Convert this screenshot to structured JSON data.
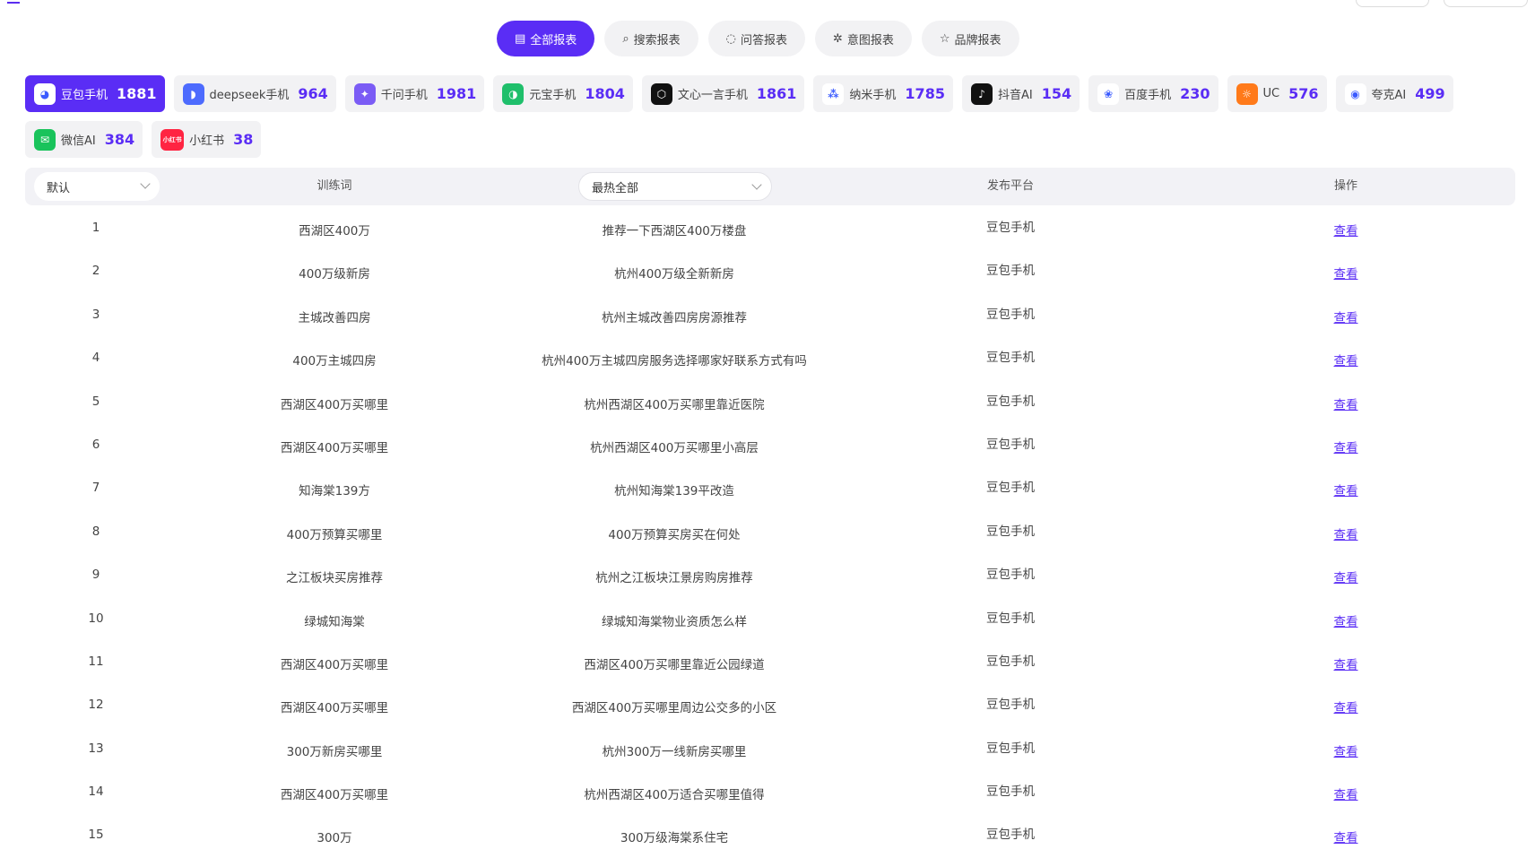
{
  "report_tabs": [
    {
      "label": "全部报表",
      "icon": "document-icon",
      "glyph": "▤",
      "active": true
    },
    {
      "label": "搜索报表",
      "icon": "search-icon",
      "glyph": "⌕",
      "active": false
    },
    {
      "label": "问答报表",
      "icon": "chat-bubble-icon",
      "glyph": "◌",
      "active": false
    },
    {
      "label": "意图报表",
      "icon": "sparkle-icon",
      "glyph": "✲",
      "active": false
    },
    {
      "label": "品牌报表",
      "icon": "star-icon",
      "glyph": "☆",
      "active": false
    }
  ],
  "platforms": [
    {
      "name": "豆包手机",
      "count": "1881",
      "logo": "doubao-logo-icon",
      "color": "#ffffff",
      "glyph": "◕",
      "active": true
    },
    {
      "name": "deepseek手机",
      "count": "964",
      "logo": "deepseek-logo-icon",
      "color": "#4d6bfe",
      "glyph": "◗",
      "active": false
    },
    {
      "name": "千问手机",
      "count": "1981",
      "logo": "qianwen-logo-icon",
      "color": "#7b5cf5",
      "glyph": "✦",
      "active": false
    },
    {
      "name": "元宝手机",
      "count": "1804",
      "logo": "yuanbao-logo-icon",
      "color": "#1fbf6b",
      "glyph": "◑",
      "active": false
    },
    {
      "name": "文心一言手机",
      "count": "1861",
      "logo": "wenxin-logo-icon",
      "color": "#111111",
      "glyph": "⬡",
      "active": false
    },
    {
      "name": "纳米手机",
      "count": "1785",
      "logo": "nami-logo-icon",
      "color": "#ffffff",
      "glyph": "⁂",
      "active": false
    },
    {
      "name": "抖音AI",
      "count": "154",
      "logo": "douyin-logo-icon",
      "color": "#111111",
      "glyph": "♪",
      "active": false
    },
    {
      "name": "百度手机",
      "count": "230",
      "logo": "baidu-logo-icon",
      "color": "#ffffff",
      "glyph": "❀",
      "active": false
    },
    {
      "name": "UC",
      "count": "576",
      "logo": "uc-logo-icon",
      "color": "#ff7a1a",
      "glyph": "☼",
      "active": false
    },
    {
      "name": "夸克AI",
      "count": "499",
      "logo": "quark-logo-icon",
      "color": "#ffffff",
      "glyph": "◉",
      "active": false
    },
    {
      "name": "微信AI",
      "count": "384",
      "logo": "wechat-logo-icon",
      "color": "#19c35b",
      "glyph": "✉",
      "active": false
    },
    {
      "name": "小红书",
      "count": "38",
      "logo": "xiaohongshu-logo-icon",
      "color": "#ff2442",
      "glyph": "小红书",
      "active": false
    }
  ],
  "table": {
    "default_select": "默认",
    "headers": {
      "keyword": "训练词",
      "platform": "发布平台",
      "action": "操作"
    },
    "hot_select": "最热全部",
    "rows": [
      {
        "no": "1",
        "keyword": "西湖区400万",
        "question": "推荐一下西湖区400万楼盘",
        "platform": "豆包手机",
        "action": "查看"
      },
      {
        "no": "2",
        "keyword": "400万级新房",
        "question": "杭州400万级全新新房",
        "platform": "豆包手机",
        "action": "查看"
      },
      {
        "no": "3",
        "keyword": "主城改善四房",
        "question": "杭州主城改善四房房源推荐",
        "platform": "豆包手机",
        "action": "查看"
      },
      {
        "no": "4",
        "keyword": "400万主城四房",
        "question": "杭州400万主城四房服务选择哪家好联系方式有吗",
        "platform": "豆包手机",
        "action": "查看"
      },
      {
        "no": "5",
        "keyword": "西湖区400万买哪里",
        "question": "杭州西湖区400万买哪里靠近医院",
        "platform": "豆包手机",
        "action": "查看"
      },
      {
        "no": "6",
        "keyword": "西湖区400万买哪里",
        "question": "杭州西湖区400万买哪里小高层",
        "platform": "豆包手机",
        "action": "查看"
      },
      {
        "no": "7",
        "keyword": "知海棠139方",
        "question": "杭州知海棠139平改造",
        "platform": "豆包手机",
        "action": "查看"
      },
      {
        "no": "8",
        "keyword": "400万预算买哪里",
        "question": "400万预算买房买在何处",
        "platform": "豆包手机",
        "action": "查看"
      },
      {
        "no": "9",
        "keyword": "之江板块买房推荐",
        "question": "杭州之江板块江景房购房推荐",
        "platform": "豆包手机",
        "action": "查看"
      },
      {
        "no": "10",
        "keyword": "绿城知海棠",
        "question": "绿城知海棠物业资质怎么样",
        "platform": "豆包手机",
        "action": "查看"
      },
      {
        "no": "11",
        "keyword": "西湖区400万买哪里",
        "question": "西湖区400万买哪里靠近公园绿道",
        "platform": "豆包手机",
        "action": "查看"
      },
      {
        "no": "12",
        "keyword": "西湖区400万买哪里",
        "question": "西湖区400万买哪里周边公交多的小区",
        "platform": "豆包手机",
        "action": "查看"
      },
      {
        "no": "13",
        "keyword": "300万新房买哪里",
        "question": "杭州300万一线新房买哪里",
        "platform": "豆包手机",
        "action": "查看"
      },
      {
        "no": "14",
        "keyword": "西湖区400万买哪里",
        "question": "杭州西湖区400万适合买哪里值得",
        "platform": "豆包手机",
        "action": "查看"
      },
      {
        "no": "15",
        "keyword": "300万",
        "question": "300万级海棠系住宅",
        "platform": "豆包手机",
        "action": "查看"
      }
    ]
  }
}
